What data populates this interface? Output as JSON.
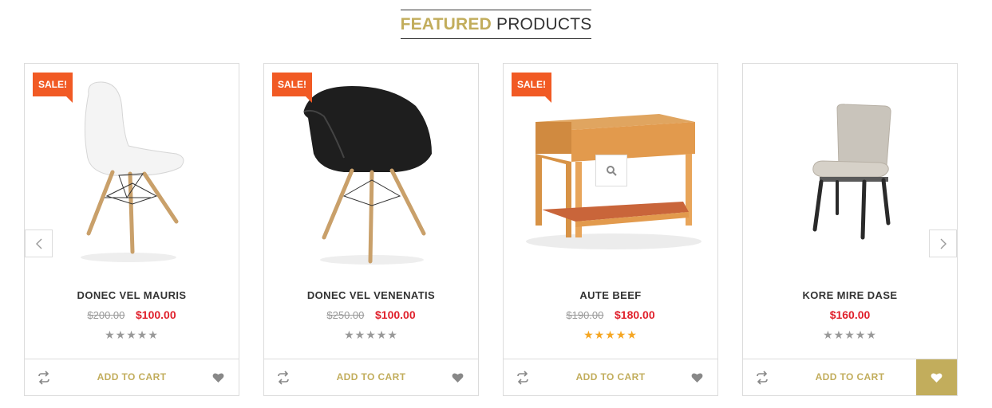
{
  "section": {
    "title_accent": "FEATURED",
    "title_rest": "PRODUCTS"
  },
  "colors": {
    "accent": "#c2ad5c",
    "sale": "#f15a24",
    "price": "#e0212c",
    "star_gold": "#f5a623",
    "star_grey": "#999999"
  },
  "products": [
    {
      "sale_label": "SALE!",
      "name": "DONEC VEL MAURIS",
      "old_price": "$200.00",
      "price": "$100.00",
      "rating": 0,
      "image_icon": "white-eames-chair",
      "add_to_cart": "ADD TO CART"
    },
    {
      "sale_label": "SALE!",
      "name": "DONEC VEL VENENATIS",
      "old_price": "$250.00",
      "price": "$100.00",
      "rating": 0,
      "image_icon": "black-armchair",
      "add_to_cart": "ADD TO CART"
    },
    {
      "sale_label": "SALE!",
      "name": "AUTE BEEF",
      "old_price": "$190.00",
      "price": "$180.00",
      "rating": 5,
      "image_icon": "wooden-side-table",
      "add_to_cart": "ADD TO CART"
    },
    {
      "name": "KORE MIRE DASE",
      "price": "$160.00",
      "rating": 0,
      "image_icon": "upholstered-chair",
      "add_to_cart": "ADD TO CART"
    }
  ],
  "icons": {
    "prev": "chevron-left-icon",
    "next": "chevron-right-icon",
    "compare": "refresh-icon",
    "wishlist": "heart-icon",
    "quickview": "search-icon",
    "star": "star-icon"
  }
}
